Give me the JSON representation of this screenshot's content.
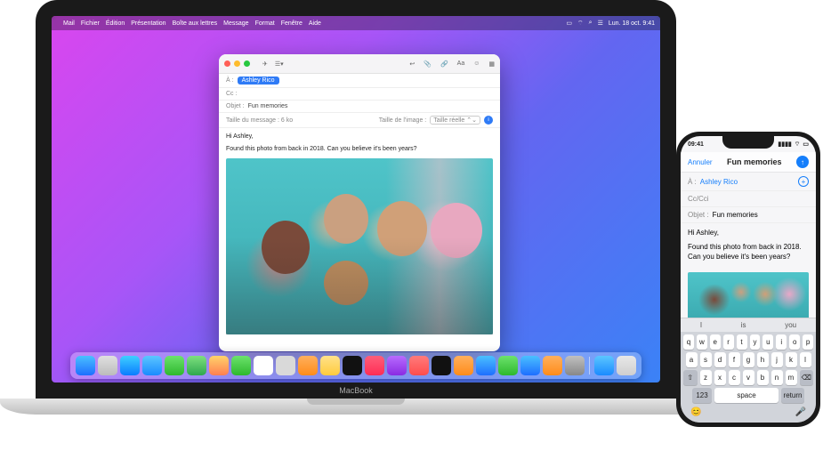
{
  "menubar": {
    "app": "Mail",
    "items": [
      "Fichier",
      "Édition",
      "Présentation",
      "Boîte aux lettres",
      "Message",
      "Format",
      "Fenêtre",
      "Aide"
    ],
    "clock": "Lun. 18 oct. 9:41"
  },
  "mail": {
    "to_label": "À :",
    "to_value": "Ashley Rico",
    "cc_label": "Cc :",
    "subject_label": "Objet :",
    "subject_value": "Fun memories",
    "msg_size_label": "Taille du message : 6 ko",
    "img_size_label": "Taille de l'image :",
    "img_size_value": "Taille réelle",
    "greeting": "Hi Ashley,",
    "body": "Found this photo from back in 2018. Can you believe it's been years?"
  },
  "dock_apps": [
    "finder",
    "launchpad",
    "safari",
    "mail",
    "messages",
    "maps",
    "photos",
    "facetime",
    "calendar",
    "contacts",
    "reminders",
    "notes",
    "tv",
    "music",
    "podcasts",
    "news",
    "stocks",
    "books",
    "appstore",
    "numbers",
    "keynote",
    "pages",
    "settings"
  ],
  "iphone": {
    "time": "09:41",
    "cancel": "Annuler",
    "title": "Fun memories",
    "to_label": "À :",
    "to_value": "Ashley Rico",
    "cc_label": "Cc/Cci",
    "subject_label": "Objet :",
    "subject_value": "Fun memories",
    "greeting": "Hi Ashley,",
    "body": "Found this photo from back in 2018. Can you believe it's been years?",
    "qt": [
      "I",
      "is",
      "you"
    ],
    "rows": [
      [
        "q",
        "w",
        "e",
        "r",
        "t",
        "y",
        "u",
        "i",
        "o",
        "p"
      ],
      [
        "a",
        "s",
        "d",
        "f",
        "g",
        "h",
        "j",
        "k",
        "l"
      ],
      [
        "z",
        "x",
        "c",
        "v",
        "b",
        "n",
        "m"
      ]
    ],
    "shift": "⇧",
    "del": "⌫",
    "numkey": "123",
    "space": "space",
    "return": "return",
    "emoji": "😊",
    "mic": "🎤"
  }
}
